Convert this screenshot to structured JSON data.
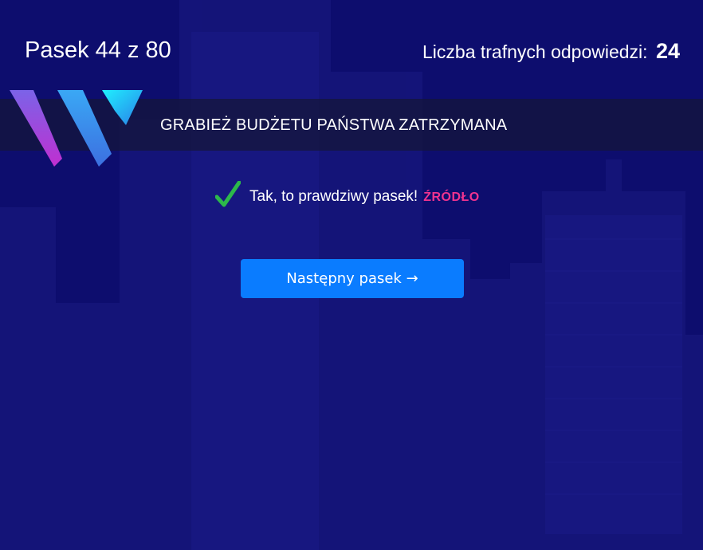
{
  "quiz": {
    "counter_label": "Pasek 44 z 80",
    "score_label": "Liczba trafnych odpowiedzi:",
    "score_value": "24"
  },
  "ticker": {
    "headline": "GRABIEŻ BUDŻETU PAŃSTWA ZATRZYMANA"
  },
  "result": {
    "icon": "check-icon",
    "message": "Tak, to prawdziwy pasek!",
    "source_label": "ŹRÓDŁO"
  },
  "actions": {
    "next_label": "Następny pasek →"
  },
  "colors": {
    "background": "#0d0d6e",
    "ticker_bg": "#14163c",
    "button": "#0a7cff",
    "check": "#2db84b",
    "source_link": "#f0338f",
    "text": "#ffffff"
  }
}
